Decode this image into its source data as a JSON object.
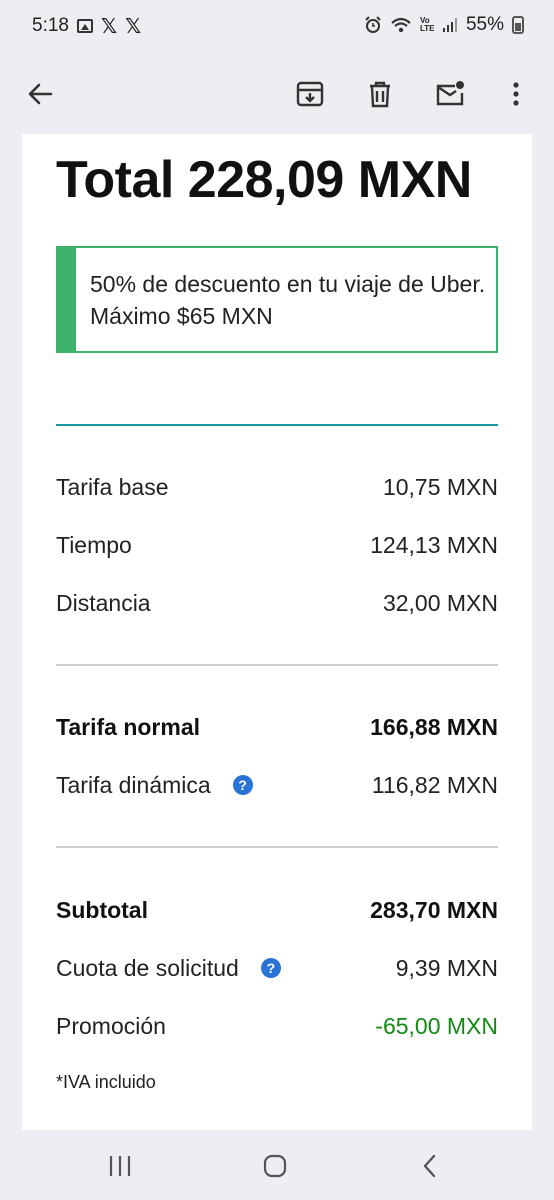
{
  "status": {
    "time": "5:18",
    "battery": "55%",
    "network": "Vo LTE"
  },
  "app_bar": {
    "icons": [
      "back-arrow-icon",
      "archive-icon",
      "trash-icon",
      "mark-unread-icon",
      "more-vert-icon"
    ]
  },
  "receipt": {
    "total": "Total 228,09 MXN",
    "promo_text": "50% de descuento en tu viaje de Uber. Máximo $65 MXN",
    "section1": [
      {
        "label": "Tarifa base",
        "value": "10,75 MXN"
      },
      {
        "label": "Tiempo",
        "value": "124,13 MXN"
      },
      {
        "label": "Distancia",
        "value": "32,00 MXN"
      }
    ],
    "section2": [
      {
        "label": "Tarifa normal",
        "value": "166,88 MXN"
      },
      {
        "label": "Tarifa dinámica",
        "value": "116,82 MXN"
      }
    ],
    "section3": [
      {
        "label": "Subtotal",
        "value": "283,70 MXN"
      },
      {
        "label": "Cuota de solicitud",
        "value": "9,39 MXN"
      },
      {
        "label": "Promoción",
        "value": "-65,00 MXN"
      }
    ],
    "footnote": "*IVA incluido",
    "help_glyph": "?"
  },
  "colors": {
    "accent_green": "#3eb26c",
    "divider_teal": "#1a9aa0",
    "promo_value": "#128a12",
    "help_blue": "#2a73d6"
  }
}
